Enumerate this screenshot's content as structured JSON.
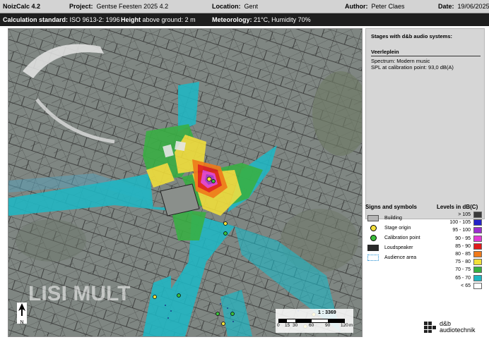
{
  "header": {
    "app": "NoizCalc 4.2",
    "project_label": "Project:",
    "project": "Gentse Feesten 2025 4.2",
    "location_label": "Location:",
    "location": "Gent",
    "author_label": "Author:",
    "author": "Peter Claes",
    "date_label": "Date:",
    "date": "19/06/2025"
  },
  "subheader": {
    "calc_label": "Calculation standard:",
    "calc": "ISO 9613-2: 1996",
    "height_label": "Height",
    "height_suffix": "above ground: 2 m",
    "meteo_label": "Meteorology:",
    "meteo": "21°C, Humidity 70%"
  },
  "stages_panel": {
    "title": "Stages with d&b audio systems:",
    "stage_name": "Veerleplein",
    "spectrum": "Spectrum:  Modern music",
    "spl": "SPL at calibration point:  93,0 dB(A)"
  },
  "map": {
    "scale_ratio": "1 : 3369",
    "scale_ticks": [
      "0",
      "15",
      "30",
      "60",
      "90",
      "120"
    ],
    "scale_unit": "m",
    "north": "N",
    "watermark": "LISI MULT"
  },
  "symbols": {
    "title": "Signs and symbols",
    "items": [
      {
        "label": "Building",
        "icon": "building-swatch"
      },
      {
        "label": "Stage origin",
        "icon": "yellow-dot"
      },
      {
        "label": "Calibration point",
        "icon": "green-dot"
      },
      {
        "label": "Loudspeaker",
        "icon": "loudspeaker-swatch"
      },
      {
        "label": "Audience area",
        "icon": "dotted-outline"
      }
    ]
  },
  "levels": {
    "title": "Levels in dB(C)",
    "items": [
      {
        "label": "> 105",
        "color": "#3a3a3a"
      },
      {
        "label": "100 - 105",
        "color": "#2323c8"
      },
      {
        "label": "95 - 100",
        "color": "#9b2fd0"
      },
      {
        "label": "90 - 95",
        "color": "#e23ad6"
      },
      {
        "label": "85 - 90",
        "color": "#e01b1b"
      },
      {
        "label": "80 - 85",
        "color": "#f07a1a"
      },
      {
        "label": "75 - 80",
        "color": "#f3e03a"
      },
      {
        "label": "70 - 75",
        "color": "#38b043"
      },
      {
        "label": "65 - 70",
        "color": "#1fb7c4"
      },
      {
        "label": "< 65",
        "color": "#ffffff"
      }
    ]
  },
  "brand": {
    "line1": "d&b",
    "line2": "audiotechnik"
  }
}
